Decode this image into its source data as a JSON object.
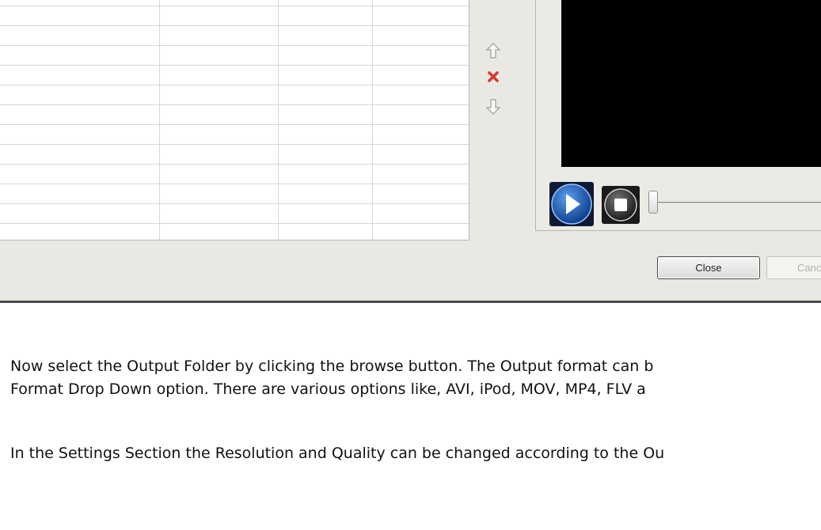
{
  "dialog": {
    "buttons": {
      "close_label": "Close",
      "cancel_label": "Cancel"
    },
    "side_controls": [
      "move-up",
      "remove",
      "move-down"
    ],
    "media_controls": [
      "play",
      "stop"
    ]
  },
  "document": {
    "paragraph1_line1": "Now select the Output Folder by clicking the browse button. The Output format can b",
    "paragraph1_line2": "Format Drop Down option. There are various options like, AVI, iPod, MOV, MP4, FLV a",
    "paragraph2": "In the Settings Section the Resolution and Quality can be changed according to the Ou"
  },
  "colors": {
    "dialog_bg": "#e9e8e3",
    "video_bg": "#000000",
    "play_button": "#1f5fb5",
    "remove_icon": "#d63a2f"
  }
}
